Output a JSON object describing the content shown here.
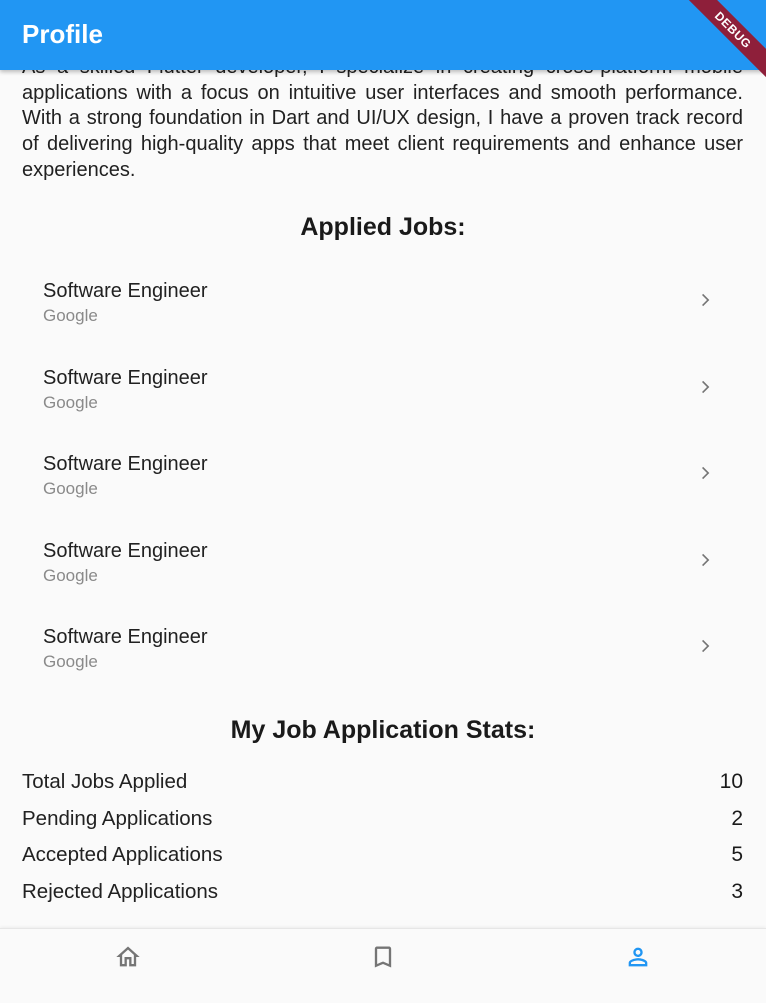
{
  "appbar": {
    "title": "Profile",
    "debug_label": "DEBUG"
  },
  "bio": "As a skilled Flutter developer, I specialize in creating cross-platform mobile applications with a focus on intuitive user interfaces and smooth performance. With a strong foundation in Dart and UI/UX design, I have a proven track record of delivering high-quality apps that meet client requirements and enhance user experiences.",
  "applied_jobs": {
    "title": "Applied Jobs:",
    "items": [
      {
        "title": "Software Engineer",
        "company": "Google",
        "icon": "chevron-right-icon"
      },
      {
        "title": "Software Engineer",
        "company": "Google",
        "icon": "chevron-right-icon"
      },
      {
        "title": "Software Engineer",
        "company": "Google",
        "icon": "chevron-right-icon"
      },
      {
        "title": "Software Engineer",
        "company": "Google",
        "icon": "chevron-right-icon"
      },
      {
        "title": "Software Engineer",
        "company": "Google",
        "icon": "chevron-right-icon"
      }
    ]
  },
  "stats": {
    "title": "My Job Application Stats:",
    "rows": [
      {
        "label": "Total Jobs Applied",
        "value": "10"
      },
      {
        "label": "Pending Applications",
        "value": "2"
      },
      {
        "label": "Accepted Applications",
        "value": "5"
      },
      {
        "label": "Rejected Applications",
        "value": "3"
      }
    ]
  },
  "bottom_nav": {
    "items": [
      {
        "icon": "home-icon",
        "active": false
      },
      {
        "icon": "bookmark-icon",
        "active": false
      },
      {
        "icon": "person-icon",
        "active": true
      }
    ]
  },
  "colors": {
    "primary": "#2196f3",
    "inactive_icon": "#757575",
    "debug_banner": "#8e1f3a"
  }
}
